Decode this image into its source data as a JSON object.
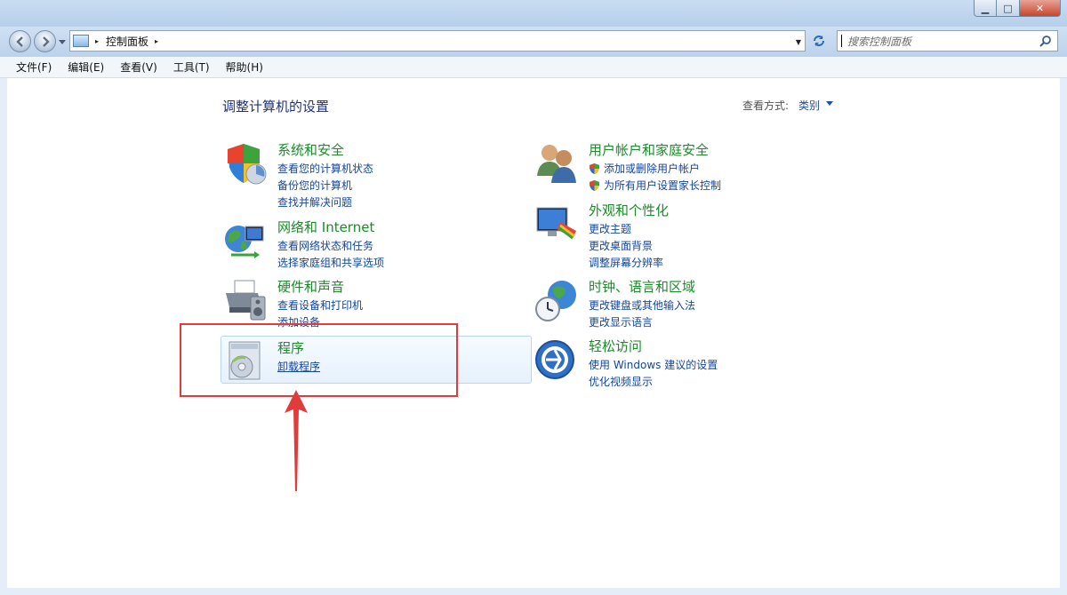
{
  "window": {
    "min_glyph": "▁",
    "max_glyph": "□",
    "close_glyph": "✕"
  },
  "address": {
    "breadcrumb": "控制面板",
    "separator": "▸"
  },
  "search": {
    "placeholder": "搜索控制面板"
  },
  "menu": [
    "文件(F)",
    "编辑(E)",
    "查看(V)",
    "工具(T)",
    "帮助(H)"
  ],
  "content": {
    "heading": "调整计算机的设置",
    "view_by_label": "查看方式:",
    "view_by_value": "类别"
  },
  "categories": {
    "system": {
      "title": "系统和安全",
      "icon": "security-shield-icon",
      "links": [
        "查看您的计算机状态",
        "备份您的计算机",
        "查找并解决问题"
      ]
    },
    "network": {
      "title": "网络和 Internet",
      "icon": "network-globe-icon",
      "links": [
        "查看网络状态和任务",
        "选择家庭组和共享选项"
      ]
    },
    "hardware": {
      "title": "硬件和声音",
      "icon": "printer-speaker-icon",
      "links": [
        "查看设备和打印机",
        "添加设备"
      ]
    },
    "programs": {
      "title": "程序",
      "icon": "programs-disc-icon",
      "links": [
        "卸载程序"
      ]
    },
    "users": {
      "title": "用户帐户和家庭安全",
      "icon": "users-icon",
      "links": [
        "添加或删除用户帐户",
        "为所有用户设置家长控制"
      ]
    },
    "appearance": {
      "title": "外观和个性化",
      "icon": "monitor-palette-icon",
      "links": [
        "更改主题",
        "更改桌面背景",
        "调整屏幕分辨率"
      ]
    },
    "clock": {
      "title": "时钟、语言和区域",
      "icon": "clock-globe-icon",
      "links": [
        "更改键盘或其他输入法",
        "更改显示语言"
      ]
    },
    "access": {
      "title": "轻松访问",
      "icon": "ease-of-access-icon",
      "links": [
        "使用 Windows 建议的设置",
        "优化视频显示"
      ]
    }
  },
  "colors": {
    "category_title": "#1c8a2a",
    "link": "#1446a0",
    "annotation": "#e23b3b"
  }
}
